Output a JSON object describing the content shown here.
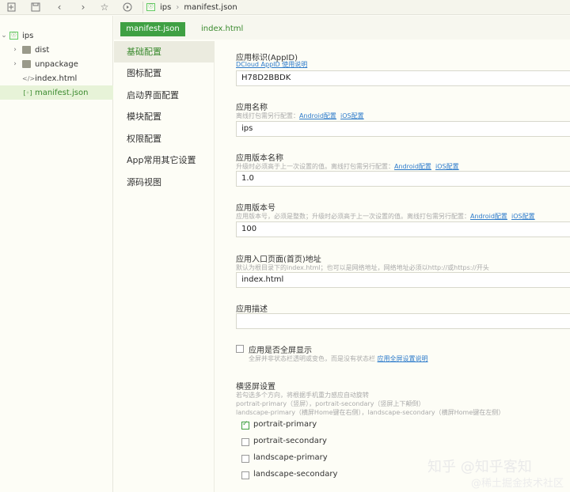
{
  "toolbar": {
    "icons": [
      "new-file-icon",
      "save-icon",
      "back-icon",
      "forward-icon",
      "star-icon",
      "run-icon"
    ],
    "breadcrumb": [
      "ips",
      "manifest.json"
    ]
  },
  "tree": {
    "root": "ips",
    "items": [
      "dist",
      "unpackage",
      "index.html",
      "manifest.json"
    ]
  },
  "tabs": {
    "active": "manifest.json",
    "other": "index.html"
  },
  "nav": {
    "items": [
      "基础配置",
      "图标配置",
      "启动界面配置",
      "模块配置",
      "权限配置",
      "App常用其它设置",
      "源码视图"
    ]
  },
  "form": {
    "appid": {
      "label": "应用标识(AppID)",
      "hint_link": "DCloud AppID 使用说明",
      "value": "H78D2BBDK"
    },
    "name": {
      "label": "应用名称",
      "hint": "离线打包需另行配置：",
      "android_link": "Android配置",
      "ios_link": "iOS配置",
      "value": "ips"
    },
    "version_name": {
      "label": "应用版本名称",
      "hint": "升级时必须高于上一次设置的值。离线打包需另行配置：",
      "android_link": "Android配置",
      "ios_link": "iOS配置",
      "value": "1.0"
    },
    "version_code": {
      "label": "应用版本号",
      "hint": "应用版本号，必须是整数；升级时必须高于上一次设置的值。离线打包需另行配置：",
      "android_link": "Android配置",
      "ios_link": "iOS配置",
      "value": "100"
    },
    "entry": {
      "label": "应用入口页面(首页)地址",
      "hint": "默认为根目录下的index.html；也可以是网络地址，网络地址必须以http://或https://开头",
      "value": "index.html"
    },
    "description": {
      "label": "应用描述",
      "value": ""
    },
    "fullscreen": {
      "label": "应用是否全屏显示",
      "hint": "全屏并非状态栏透明或变色，而是没有状态栏",
      "link": "应用全屏设置说明",
      "checked": false
    },
    "orientation": {
      "label": "横竖屏设置",
      "hint1": "若勾选多个方向，将根据手机重力感应自动旋转",
      "hint2": "portrait-primary（竖屏），portrait-secondary（竖屏上下颠倒）",
      "hint3": "landscape-primary（横屏Home键在右侧），landscape-secondary（横屏Home键在左侧）",
      "options": [
        {
          "label": "portrait-primary",
          "checked": true
        },
        {
          "label": "portrait-secondary",
          "checked": false
        },
        {
          "label": "landscape-primary",
          "checked": false
        },
        {
          "label": "landscape-secondary",
          "checked": false
        }
      ]
    }
  },
  "watermark": {
    "line1": "知乎 @知乎客知",
    "line2": "@稀土掘金技术社区"
  }
}
